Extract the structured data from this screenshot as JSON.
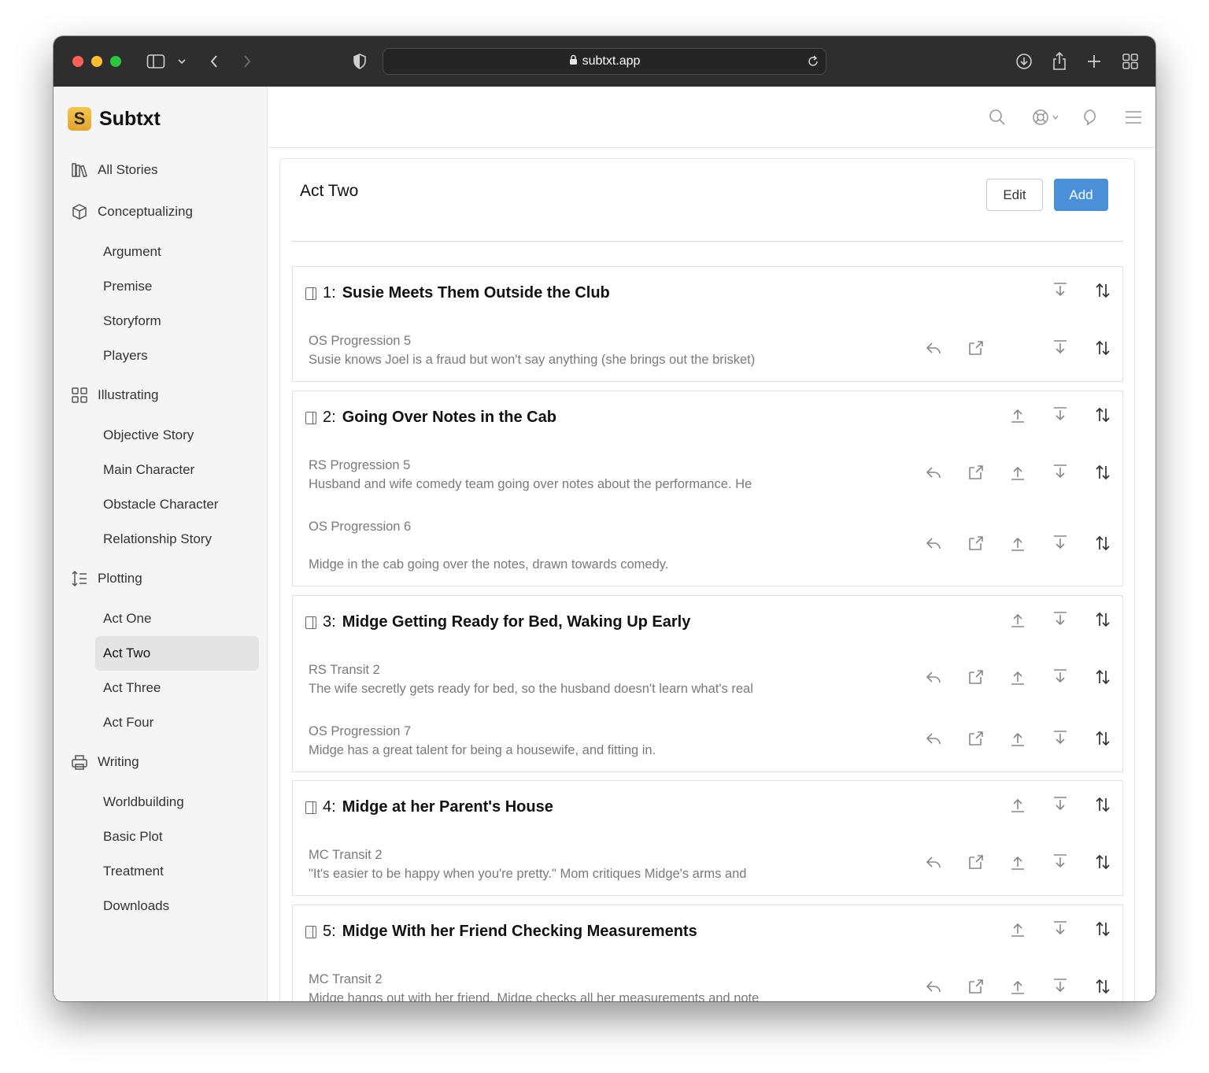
{
  "browser": {
    "url": "subtxt.app"
  },
  "brand": {
    "logo_letter": "S",
    "name": "Subtxt"
  },
  "sidebar": {
    "all_stories": "All Stories",
    "sections": [
      {
        "label": "Conceptualizing",
        "icon": "box-icon",
        "items": [
          "Argument",
          "Premise",
          "Storyform",
          "Players"
        ]
      },
      {
        "label": "Illustrating",
        "icon": "grid-icon",
        "items": [
          "Objective Story",
          "Main Character",
          "Obstacle Character",
          "Relationship Story"
        ]
      },
      {
        "label": "Plotting",
        "icon": "list-order-icon",
        "items": [
          "Act One",
          "Act Two",
          "Act Three",
          "Act Four"
        ]
      },
      {
        "label": "Writing",
        "icon": "printer-icon",
        "items": [
          "Worldbuilding",
          "Basic Plot",
          "Treatment",
          "Downloads"
        ]
      }
    ],
    "active_item": "Act Two"
  },
  "panel": {
    "title": "Act Two",
    "edit_label": "Edit",
    "add_label": "Add"
  },
  "scenes": [
    {
      "num": "1:",
      "title": "Susie Meets Them Outside the Club",
      "beats": [
        {
          "label": "OS Progression 5",
          "text": "Susie knows Joel is a fraud but won't say anything (she brings out the brisket)"
        }
      ]
    },
    {
      "num": "2:",
      "title": "Going Over Notes in the Cab",
      "beats": [
        {
          "label": "RS Progression 5",
          "text": "Husband and wife comedy team going over notes about the performance. He"
        },
        {
          "label": "OS Progression 6",
          "text": "Midge in the cab going over the notes, drawn towards comedy."
        }
      ]
    },
    {
      "num": "3:",
      "title": "Midge Getting Ready for Bed, Waking Up Early",
      "beats": [
        {
          "label": "RS Transit 2",
          "text": "The wife secretly gets ready for bed, so the husband doesn't learn what's real"
        },
        {
          "label": "OS Progression 7",
          "text": "Midge has a great talent for being a housewife, and fitting in."
        }
      ]
    },
    {
      "num": "4:",
      "title": "Midge at her Parent's House",
      "beats": [
        {
          "label": "MC Transit 2",
          "text": "\"It's easier to be happy when you're pretty.\" Mom critiques Midge's arms and"
        }
      ]
    },
    {
      "num": "5:",
      "title": "Midge With her Friend Checking Measurements",
      "beats": [
        {
          "label": "MC Transit 2",
          "text": "Midge hangs out with her friend. Midge checks all her measurements and note"
        }
      ]
    }
  ]
}
